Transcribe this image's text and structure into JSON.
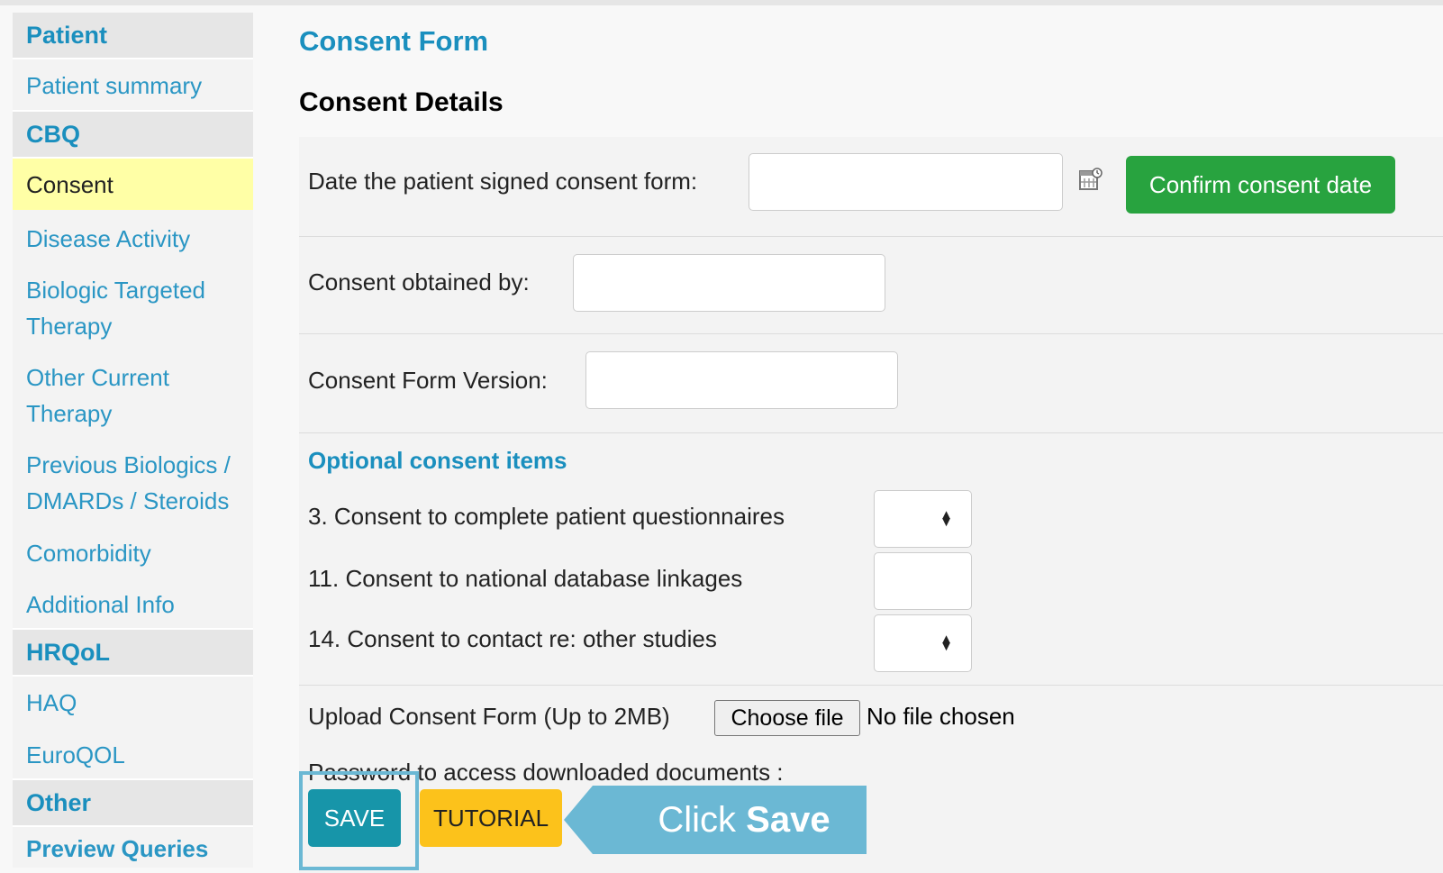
{
  "sidebar": {
    "sections": [
      {
        "title": "Patient"
      },
      {
        "title": "CBQ"
      },
      {
        "title": "HRQoL"
      },
      {
        "title": "Other"
      }
    ],
    "patient_summary": "Patient summary",
    "consent": "Consent",
    "disease_activity": "Disease Activity",
    "biologic_line1": "Biologic Targeted",
    "biologic_line2": "Therapy",
    "other_line1": "Other Current",
    "other_line2": "Therapy",
    "previous_line1": "Previous Biologics /",
    "previous_line2": "DMARDs / Steroids",
    "comorbidity": "Comorbidity",
    "additional_info": "Additional Info",
    "haq": "HAQ",
    "euroqol": "EuroQOL",
    "preview_queries": "Preview Queries"
  },
  "main": {
    "page_title": "Consent Form",
    "section_title": "Consent Details",
    "date_signed_label": "Date the patient signed consent form:",
    "date_signed_value": "",
    "confirm_button": "Confirm consent date",
    "obtained_by_label": "Consent obtained by:",
    "obtained_by_value": "",
    "version_label": "Consent Form Version:",
    "version_value": "",
    "optional_title": "Optional consent items",
    "items": [
      {
        "label": "3. Consent to complete patient questionnaires",
        "value": ""
      },
      {
        "label": "11. Consent to national database linkages",
        "value": ""
      },
      {
        "label": "14. Consent to contact re: other studies",
        "value": ""
      }
    ],
    "upload_label": "Upload Consent Form (Up to 2MB)",
    "choose_file": "Choose file",
    "no_file": "No file chosen",
    "password_label": "Password to access downloaded documents :",
    "save": "SAVE",
    "tutorial": "TUTORIAL"
  },
  "callout": {
    "prefix": "Click ",
    "bold": "Save"
  },
  "colors": {
    "accent": "#1a8fbe",
    "active_bg": "#ffffa6",
    "confirm_green": "#28a33f",
    "save_teal": "#1795a9",
    "tutorial_yellow": "#fcc21b",
    "callout_blue": "#6bb8d4"
  },
  "icons": [
    "calendar-icon",
    "select-arrows-icon",
    "arrow-left-callout"
  ]
}
